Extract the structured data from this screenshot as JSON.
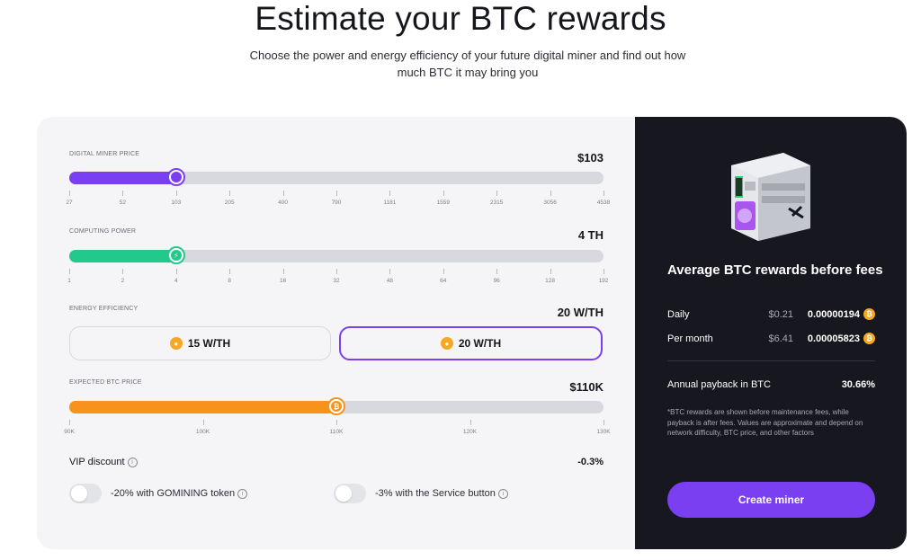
{
  "header": {
    "title": "Estimate your BTC rewards",
    "subtitle": "Choose the power and energy efficiency of your future digital miner and find out how much BTC it may bring you"
  },
  "calculator": {
    "price": {
      "label": "DIGITAL MINER PRICE",
      "value": "$103",
      "fraction": 0.2,
      "ticks": [
        "27",
        "52",
        "103",
        "205",
        "400",
        "790",
        "1181",
        "1559",
        "2315",
        "3056",
        "4538"
      ],
      "color": "#7b3ff2"
    },
    "power": {
      "label": "COMPUTING POWER",
      "value": "4 TH",
      "fraction": 0.2,
      "ticks": [
        "1",
        "2",
        "4",
        "8",
        "16",
        "32",
        "48",
        "64",
        "96",
        "128",
        "192"
      ],
      "color": "#22c98a"
    },
    "efficiency": {
      "label": "ENERGY EFFICIENCY",
      "value": "20 W/TH",
      "options": [
        {
          "label": "15 W/TH",
          "selected": false
        },
        {
          "label": "20 W/TH",
          "selected": true
        }
      ]
    },
    "btc_price": {
      "label": "EXPECTED BTC PRICE",
      "value": "$110K",
      "fraction": 0.5,
      "ticks": [
        "90K",
        "100K",
        "110K",
        "120K",
        "130K"
      ],
      "color": "#f7931a"
    },
    "vip": {
      "label": "VIP discount",
      "value": "-0.3%",
      "toggles": [
        {
          "label": "-20% with GOMINING token",
          "on": false
        },
        {
          "label": "-3% with the Service button",
          "on": false
        }
      ]
    }
  },
  "rewards": {
    "title": "Average BTC rewards before fees",
    "rows": [
      {
        "label": "Daily",
        "usd": "$0.21",
        "btc": "0.00000194"
      },
      {
        "label": "Per month",
        "usd": "$6.41",
        "btc": "0.00005823"
      }
    ],
    "payback_label": "Annual payback in BTC",
    "payback_value": "30.66%",
    "note": "*BTC rewards are shown before maintenance fees, while payback is after fees. Values are approximate and depend on network difficulty, BTC price, and other factors",
    "cta": "Create miner"
  },
  "icons": {
    "info": "info-icon",
    "bulb": "lightbulb-icon",
    "bitcoin": "bitcoin-icon",
    "bolt": "lightning-icon"
  },
  "colors": {
    "accent": "#7b3ff2",
    "green": "#22c98a",
    "orange": "#f7931a",
    "dark_panel": "#17171f"
  }
}
